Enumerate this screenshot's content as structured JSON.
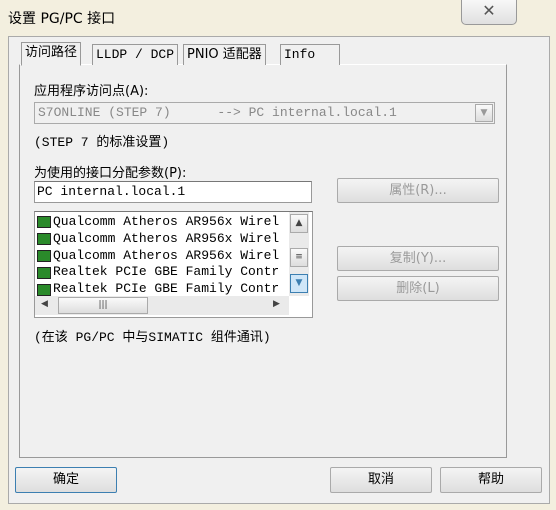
{
  "window": {
    "title": "设置 PG/PC 接口",
    "close": "✕"
  },
  "tabs": [
    {
      "label": "访问路径",
      "active": true
    },
    {
      "label": "LLDP / DCP"
    },
    {
      "label": "PNIO 适配器"
    },
    {
      "label": "Info"
    }
  ],
  "access_point": {
    "label": "应用程序访问点(A):",
    "value": "S7ONLINE (STEP 7)      --> PC internal.local.1",
    "note": "(STEP 7 的标准设置)"
  },
  "params": {
    "label": "为使用的接口分配参数(P):",
    "value": "PC internal.local.1"
  },
  "interfaces": [
    "Qualcomm Atheros AR956x Wirel",
    "Qualcomm Atheros AR956x Wirel",
    "Qualcomm Atheros AR956x Wirel",
    "Realtek PCIe GBE Family Contr",
    "Realtek PCIe GBE Family Contr"
  ],
  "buttons": {
    "properties": "属性(R)...",
    "copy": "复制(Y)...",
    "delete": "删除(L)",
    "ok": "确定",
    "cancel": "取消",
    "help": "帮助"
  },
  "footer_note": "(在该 PG/PC 中与SIMATIC 组件通讯)"
}
